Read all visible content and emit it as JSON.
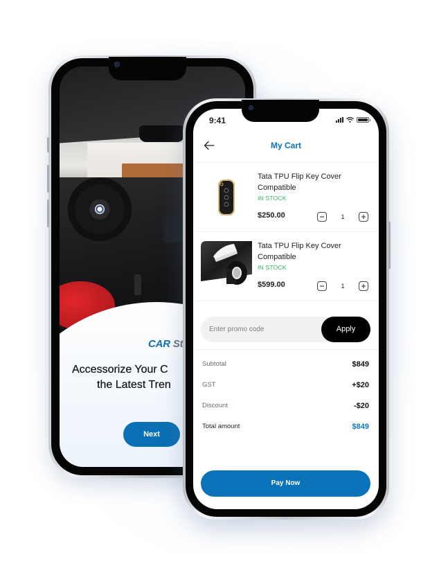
{
  "onboarding_screen": {
    "brand_primary": "CAR",
    "brand_secondary": "Stories",
    "tagline_line1": "Accessorize Your C",
    "tagline_line2": "the Latest Tren",
    "next_button_label": "Next",
    "brand_color": "#0d6fb8"
  },
  "cart_screen": {
    "status_bar": {
      "time": "9:41",
      "icons": [
        "signal-icon",
        "wifi-icon",
        "battery-icon"
      ]
    },
    "header": {
      "back_icon": "arrow-left-icon",
      "title": "My Cart"
    },
    "items": [
      {
        "name": "Tata TPU Flip Key Cover Compatible",
        "stock": "IN STOCK",
        "price": "$250.00",
        "quantity": "1",
        "image": "car-key-cover"
      },
      {
        "name": "Tata TPU Flip Key Cover Compatible",
        "stock": "IN STOCK",
        "price": "$599.00",
        "quantity": "1",
        "image": "carbon-fiber-tape"
      }
    ],
    "promo": {
      "placeholder": "Enter promo code",
      "value": "",
      "apply_label": "Apply"
    },
    "summary": {
      "subtotal_label": "Subtotal",
      "subtotal_value": "$849",
      "gst_label": "GST",
      "gst_value": "+$20",
      "discount_label": "Discount",
      "discount_value": "-$20",
      "total_label": "Total amount",
      "total_value": "$849"
    },
    "pay_button_label": "Pay Now",
    "accent_color": "#0a72b8",
    "stock_color": "#2fb35a"
  }
}
